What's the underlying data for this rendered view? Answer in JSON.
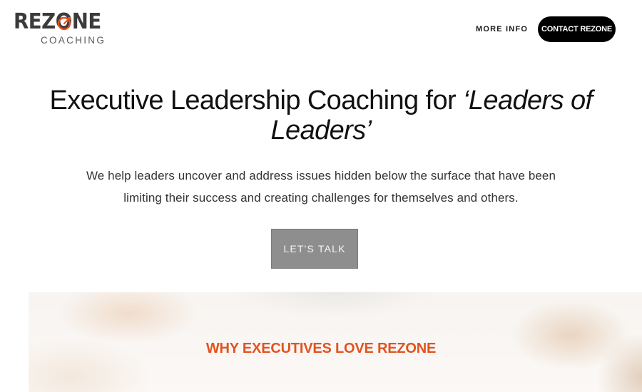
{
  "header": {
    "logo": {
      "word": "REZONE",
      "sub": "COACHING",
      "accent_color": "#e2531f",
      "icon": "target-icon"
    },
    "nav_more_info": "MORE INFO",
    "contact_button": "CONTACT REZONE"
  },
  "hero": {
    "title_main": "Executive Leadership Coaching for ",
    "title_emphasis": "‘Leaders of Leaders’",
    "subtitle": "We help leaders uncover and address issues hidden below the surface that have been limiting their success and creating challenges for themselves and others.",
    "cta_label": "LET'S TALK"
  },
  "why_section": {
    "title": "WHY EXECUTIVES LOVE REZONE",
    "title_color": "#e2531f"
  }
}
